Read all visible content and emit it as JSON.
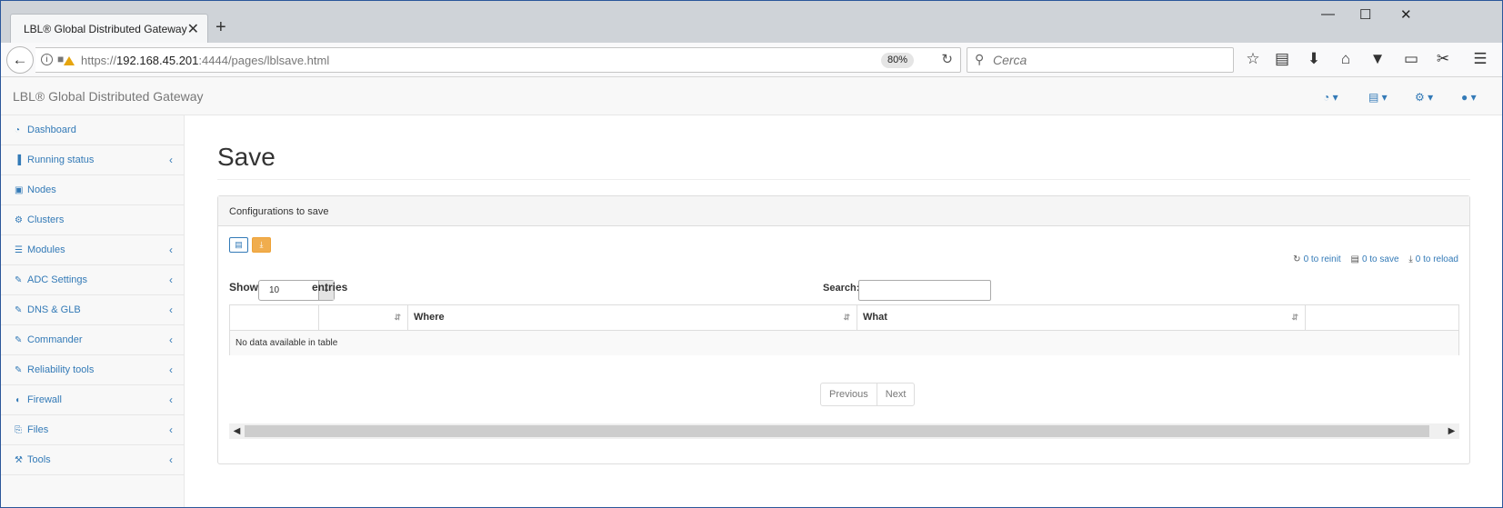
{
  "browser": {
    "tab_title": "LBL® Global Distributed Gateway",
    "close_tab": "✕",
    "new_tab": "+",
    "window_controls": {
      "minimize": "—",
      "maximize": "☐",
      "close": "✕"
    },
    "url_prefix": "https://",
    "url_host": "192.168.45.201",
    "url_rest": ":4444/pages/lblsave.html",
    "zoom": "80%",
    "search_placeholder": "Cerca",
    "toolbar_icons": [
      "star-icon",
      "reading-list-icon",
      "download-icon",
      "home-icon",
      "pocket-icon",
      "library-icon",
      "screenshot-icon",
      "menu-icon"
    ]
  },
  "app": {
    "brand": "LBL® Global Distributed Gateway",
    "header_icons": [
      "dashboard-dropdown-icon",
      "save-dropdown-icon",
      "settings-dropdown-icon",
      "user-dropdown-icon"
    ]
  },
  "sidebar": {
    "items": [
      {
        "label": "Dashboard",
        "icon": "dashboard-icon",
        "glyph": "◔",
        "has_sub": false
      },
      {
        "label": "Running status",
        "icon": "bar-chart-icon",
        "glyph": "▐",
        "has_sub": true
      },
      {
        "label": "Nodes",
        "icon": "cube-icon",
        "glyph": "▣",
        "has_sub": false
      },
      {
        "label": "Clusters",
        "icon": "cogs-icon",
        "glyph": "⚙",
        "has_sub": false
      },
      {
        "label": "Modules",
        "icon": "list-icon",
        "glyph": "☰",
        "has_sub": true
      },
      {
        "label": "ADC Settings",
        "icon": "edit-icon",
        "glyph": "✎",
        "has_sub": true
      },
      {
        "label": "DNS & GLB",
        "icon": "edit-icon",
        "glyph": "✎",
        "has_sub": true
      },
      {
        "label": "Commander",
        "icon": "edit-icon",
        "glyph": "✎",
        "has_sub": true
      },
      {
        "label": "Reliability tools",
        "icon": "edit-icon",
        "glyph": "✎",
        "has_sub": true
      },
      {
        "label": "Firewall",
        "icon": "shield-icon",
        "glyph": "◖",
        "has_sub": true
      },
      {
        "label": "Files",
        "icon": "files-icon",
        "glyph": "⎘",
        "has_sub": true
      },
      {
        "label": "Tools",
        "icon": "wrench-icon",
        "glyph": "⚒",
        "has_sub": true
      }
    ],
    "chevron": "‹"
  },
  "main": {
    "title": "Save",
    "panel_heading": "Configurations to save",
    "counters": {
      "reinit": "0 to reinit",
      "save": "0 to save",
      "reload": "0 to reload"
    },
    "show_label": "Show",
    "entries_value": "10",
    "entries_label": "entries",
    "search_label": "Search:",
    "table": {
      "columns": [
        "",
        "",
        "Where",
        "What",
        ""
      ],
      "empty_message": "No data available in table"
    },
    "pagination": {
      "previous": "Previous",
      "next": "Next"
    }
  },
  "colors": {
    "link": "#337ab7",
    "warning": "#f0ad4e",
    "border": "#dddddd"
  }
}
